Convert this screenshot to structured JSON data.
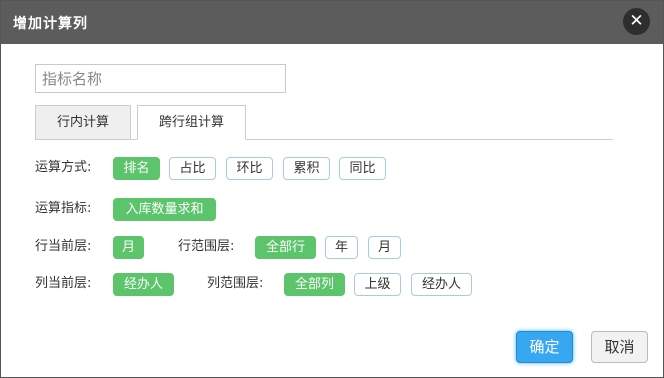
{
  "dialog": {
    "title": "增加计算列"
  },
  "name_input": {
    "placeholder": "指标名称",
    "value": ""
  },
  "tabs": [
    {
      "label": "行内计算",
      "active": false
    },
    {
      "label": "跨行组计算",
      "active": true
    }
  ],
  "calc_mode": {
    "label": "运算方式:",
    "options": [
      {
        "label": "排名",
        "selected": true
      },
      {
        "label": "占比",
        "selected": false
      },
      {
        "label": "环比",
        "selected": false
      },
      {
        "label": "累积",
        "selected": false
      },
      {
        "label": "同比",
        "selected": false
      }
    ]
  },
  "calc_metric": {
    "label": "运算指标:",
    "options": [
      {
        "label": "入库数量求和",
        "selected": true
      }
    ]
  },
  "row_current": {
    "label": "行当前层:",
    "options": [
      {
        "label": "月",
        "selected": true
      }
    ]
  },
  "row_range": {
    "label": "行范围层:",
    "options": [
      {
        "label": "全部行",
        "selected": true
      },
      {
        "label": "年",
        "selected": false
      },
      {
        "label": "月",
        "selected": false
      }
    ]
  },
  "col_current": {
    "label": "列当前层:",
    "options": [
      {
        "label": "经办人",
        "selected": true
      }
    ]
  },
  "col_range": {
    "label": "列范围层:",
    "options": [
      {
        "label": "全部列",
        "selected": true
      },
      {
        "label": "上级",
        "selected": false
      },
      {
        "label": "经办人",
        "selected": false
      }
    ]
  },
  "buttons": {
    "ok": "确定",
    "cancel": "取消"
  },
  "colors": {
    "titlebar": "#5c5c5c",
    "chip_selected": "#5cc46b",
    "chip_border": "#a9cbe0",
    "primary_button": "#37a7f1"
  }
}
